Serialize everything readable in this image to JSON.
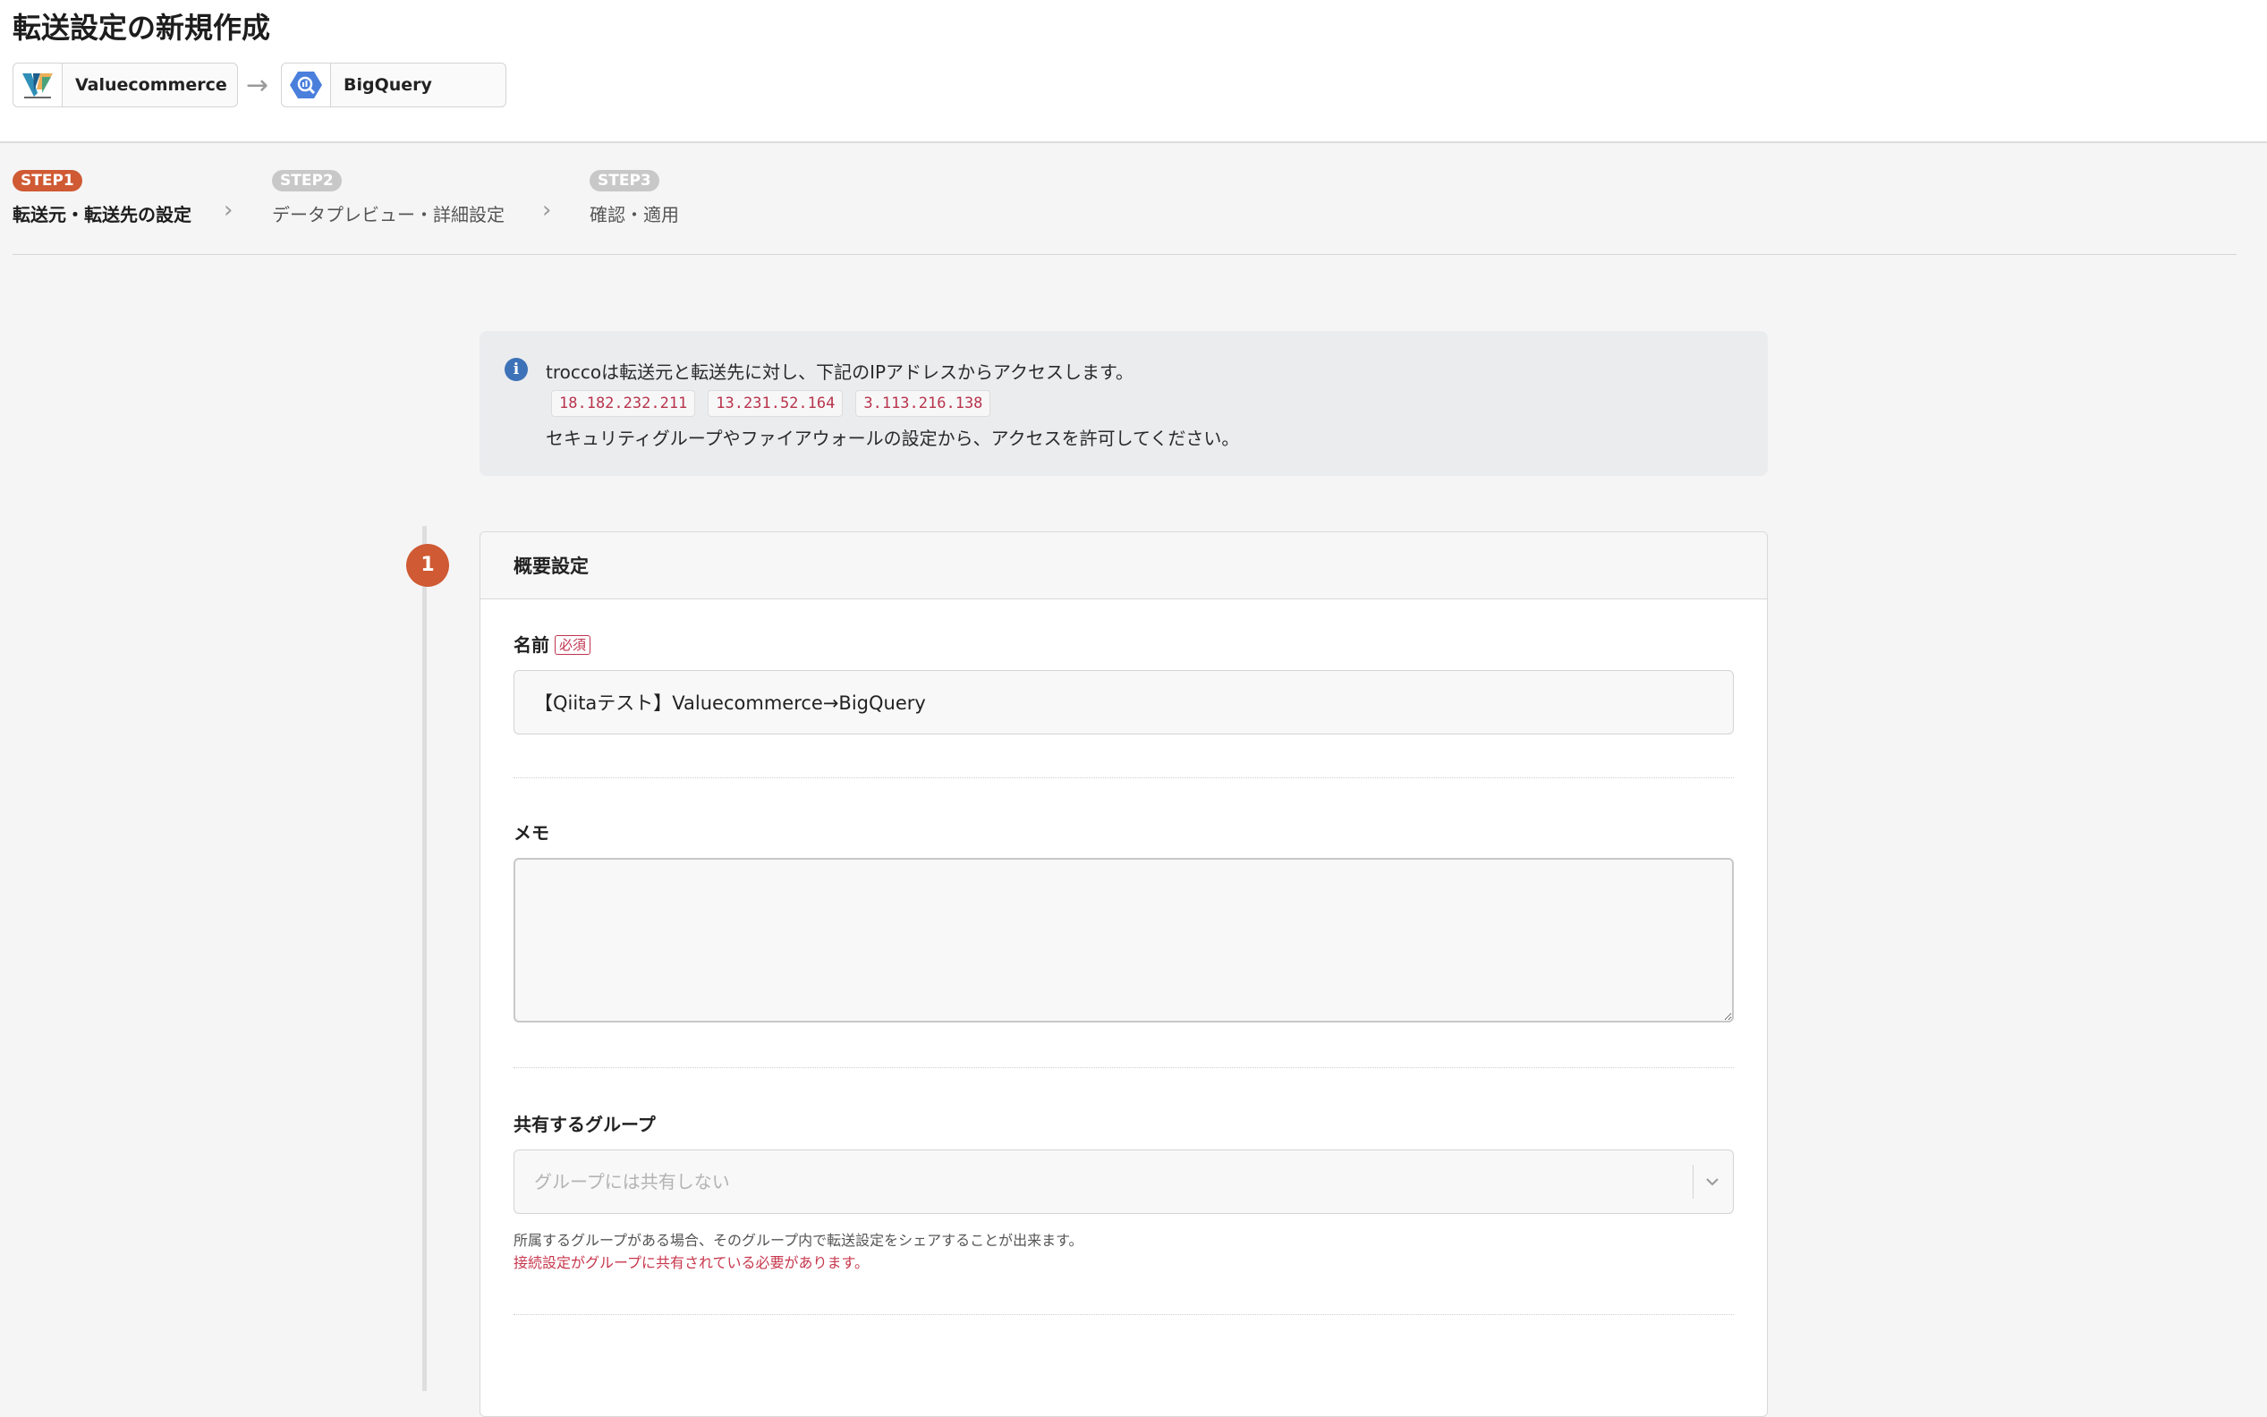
{
  "page": {
    "title": "転送設定の新規作成"
  },
  "connection": {
    "source": {
      "name": "Valuecommerce",
      "icon": "valuecommerce-logo-icon"
    },
    "arrow": "→",
    "destination": {
      "name": "BigQuery",
      "icon": "bigquery-logo-icon"
    }
  },
  "steps": [
    {
      "badge": "STEP1",
      "label": "転送元・転送先の設定",
      "active": true
    },
    {
      "badge": "STEP2",
      "label": "データプレビュー・詳細設定",
      "active": false
    },
    {
      "badge": "STEP3",
      "label": "確認・適用",
      "active": false
    }
  ],
  "info": {
    "icon": "info-icon",
    "line1": "troccoは転送元と転送先に対し、下記のIPアドレスからアクセスします。",
    "ips": [
      "18.182.232.211",
      "13.231.52.164",
      "3.113.216.138"
    ],
    "line3": "セキュリティグループやファイアウォールの設定から、アクセスを許可してください。"
  },
  "section": {
    "number": "1",
    "title": "概要設定",
    "name_field": {
      "label": "名前",
      "required_badge": "必須",
      "value": "【Qiitaテスト】Valuecommerce→BigQuery"
    },
    "memo_field": {
      "label": "メモ",
      "value": ""
    },
    "group_field": {
      "label": "共有するグループ",
      "placeholder": "グループには共有しない",
      "help": "所属するグループがある場合、そのグループ内で転送設定をシェアすることが出来ます。",
      "warning": "接続設定がグループに共有されている必要があります。"
    }
  },
  "colors": {
    "accent": "#cf5a33",
    "info": "#3d72b8",
    "warning": "#c7374d"
  }
}
